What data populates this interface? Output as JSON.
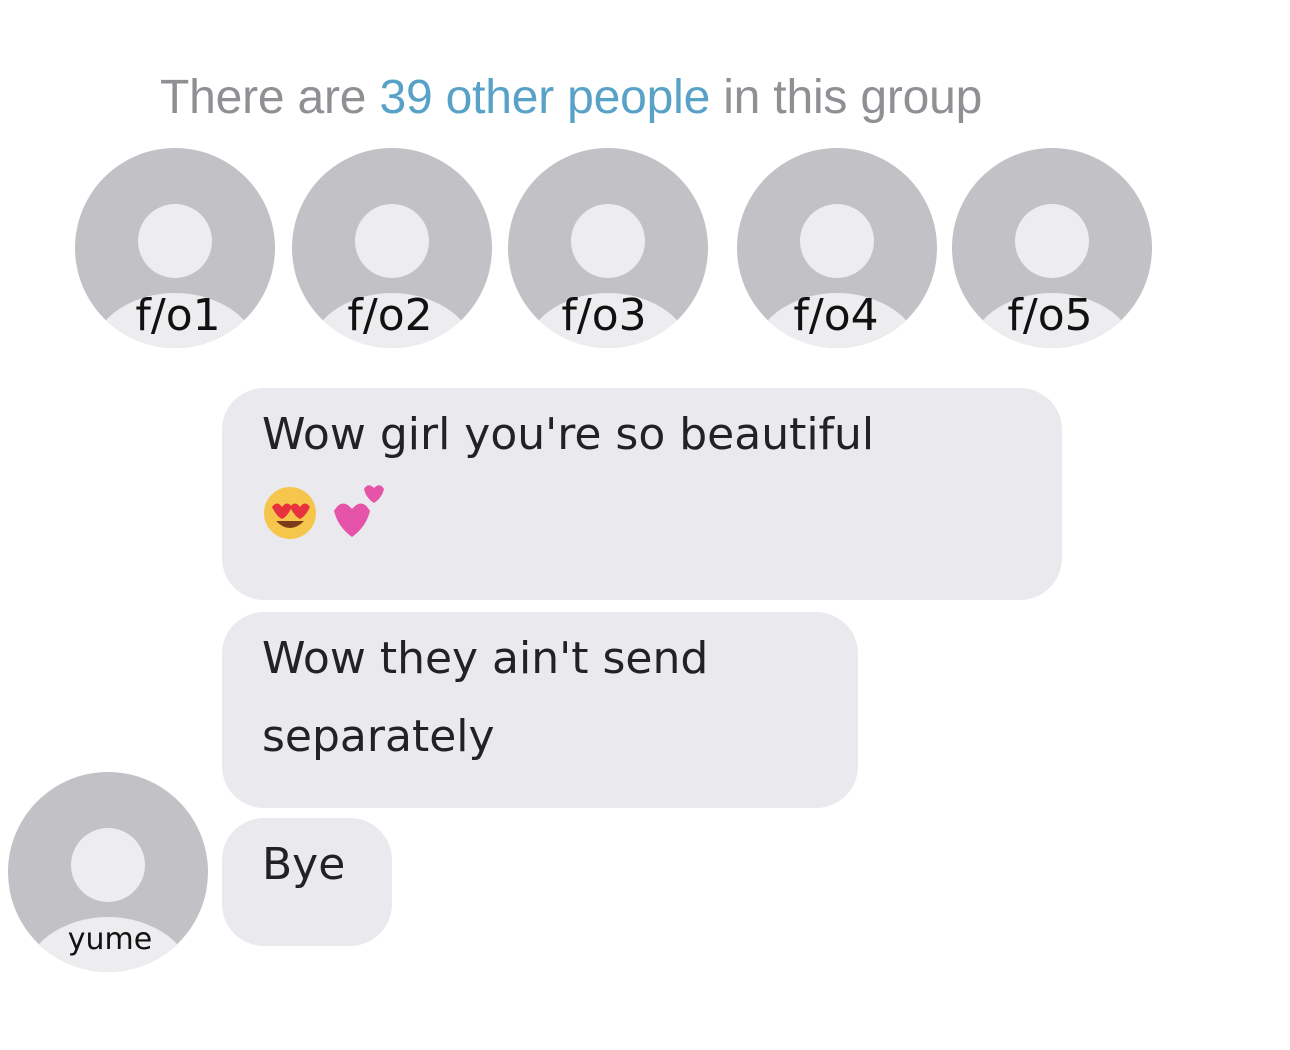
{
  "group_info": {
    "prefix": "There are ",
    "highlight": "39 other people",
    "suffix": " in this group"
  },
  "members": [
    {
      "label": "f/o1",
      "icon": "default-avatar-icon"
    },
    {
      "label": "f/o2",
      "icon": "default-avatar-icon"
    },
    {
      "label": "f/o3",
      "icon": "default-avatar-icon"
    },
    {
      "label": "f/o4",
      "icon": "default-avatar-icon"
    },
    {
      "label": "f/o5",
      "icon": "default-avatar-icon"
    }
  ],
  "messages": [
    {
      "text": "Wow girl you're so beautiful",
      "emoji": [
        "heart-eyes-emoji-icon",
        "two-hearts-emoji-icon"
      ]
    },
    {
      "line1": "Wow they ain't send",
      "line2": "separately"
    },
    {
      "text": "Bye"
    }
  ],
  "sender": {
    "label": "yume"
  },
  "colors": {
    "highlight": "#58a2c7",
    "bubble": "#e9e9ee",
    "avatar_bg": "#c2c2c6"
  }
}
